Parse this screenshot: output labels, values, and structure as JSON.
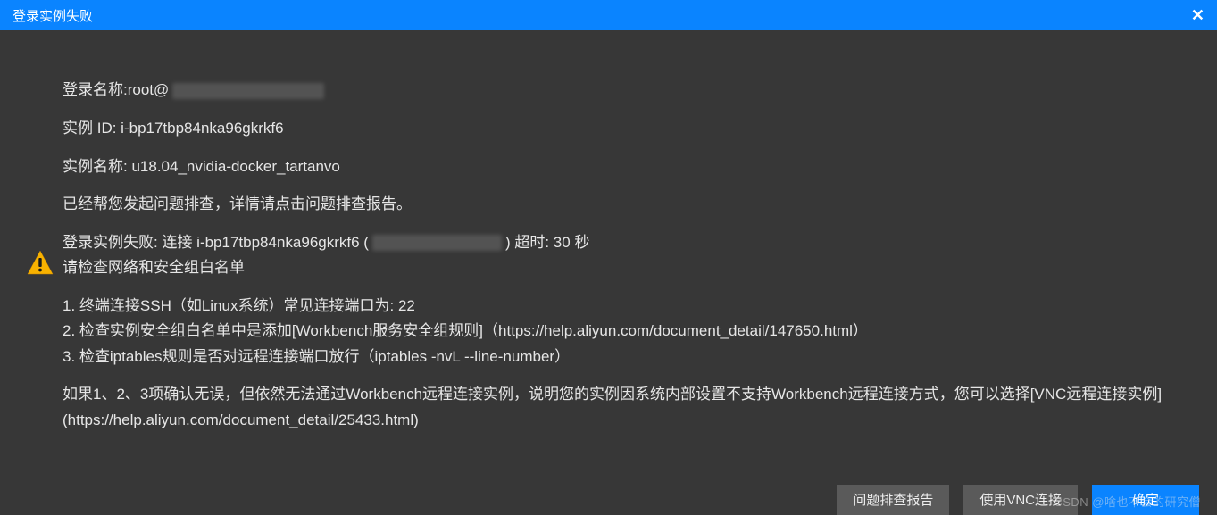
{
  "titleBar": {
    "title": "登录实例失败"
  },
  "content": {
    "loginNameLabel": "登录名称:root@",
    "instanceIdLabel": "实例 ID: ",
    "instanceId": "i-bp17tbp84nka96gkrkf6",
    "instanceNameLabel": "实例名称: ",
    "instanceName": "u18.04_nvidia-docker_tartanvo",
    "troubleshootIntro": "已经帮您发起问题排查，详情请点击问题排查报告。",
    "failurePrefix": "登录实例失败: 连接 i-bp17tbp84nka96gkrkf6 (",
    "failureSuffix": ") 超时: 30 秒",
    "checkWhitelist": "请检查网络和安全组白名单",
    "step1": "1. 终端连接SSH（如Linux系统）常见连接端口为: 22",
    "step2": "2. 检查实例安全组白名单中是添加[Workbench服务安全组规则]（https://help.aliyun.com/document_detail/147650.html）",
    "step3": "3. 检查iptables规则是否对远程连接端口放行（iptables -nvL --line-number）",
    "footerPara": "如果1、2、3项确认无误，但依然无法通过Workbench远程连接实例，说明您的实例因系统内部设置不支持Workbench远程连接方式，您可以选择[VNC远程连接实例](https://help.aliyun.com/document_detail/25433.html)"
  },
  "buttons": {
    "report": "问题排查报告",
    "vnc": "使用VNC连接",
    "ok": "确定"
  },
  "watermark": "CSDN @啥也不会的研究僧"
}
